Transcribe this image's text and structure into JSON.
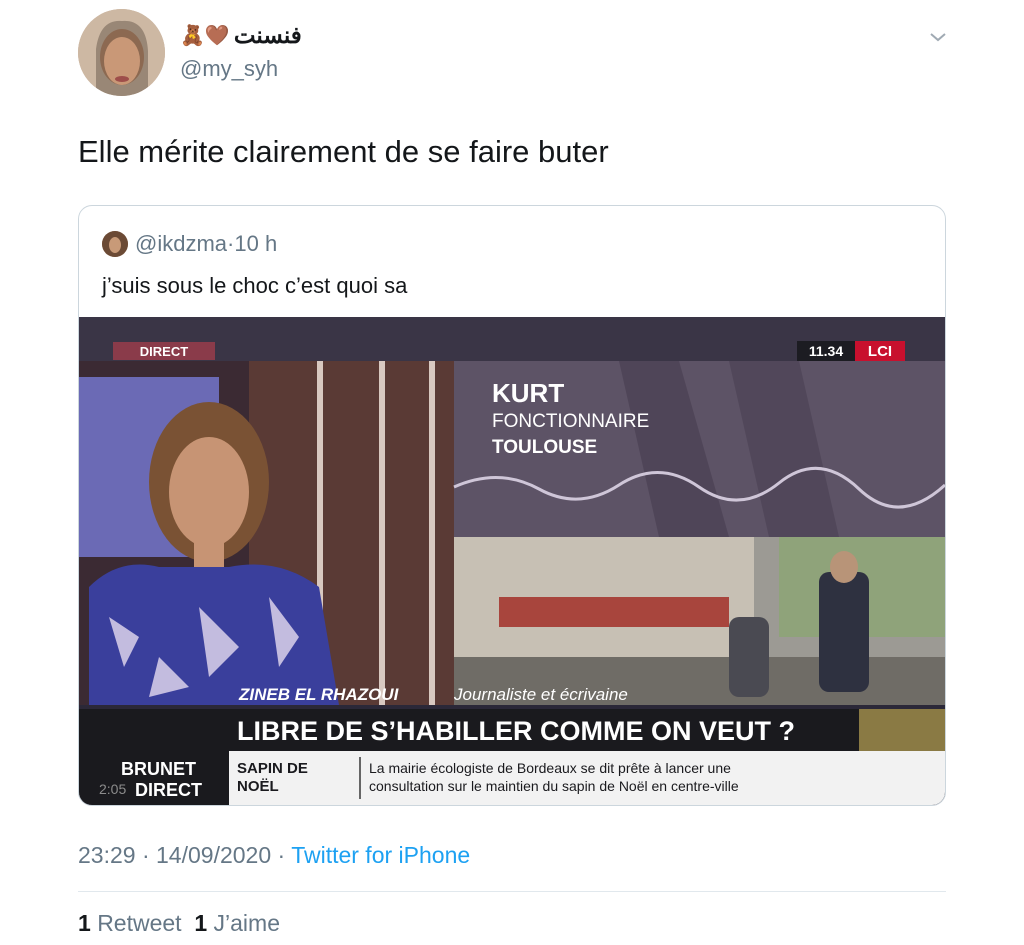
{
  "author": {
    "display_name": "فنسنت",
    "name_emoji": "🧸🤎",
    "handle": "@my_syh"
  },
  "tweet": {
    "text": "Elle mérite clairement de se faire buter"
  },
  "quoted": {
    "handle": "@ikdzma",
    "separator": "·",
    "age": "10 h",
    "text": "j’suis sous le choc c’est quoi sa",
    "video": {
      "live_badge": "DIRECT",
      "clock": "11.34",
      "channel": "LCI",
      "caller_name": "KURT",
      "caller_role": "FONCTIONNAIRE",
      "caller_city": "TOULOUSE",
      "guest_name": "ZINEB EL RHAZOUI",
      "guest_title": "Journaliste et écrivaine",
      "headline": "LIBRE DE S’HABILLER COMME ON VEUT ?",
      "show_name_1": "BRUNET",
      "show_name_2": "DIRECT",
      "timestamp": "2:05",
      "ticker_topic_1": "SAPIN DE",
      "ticker_topic_2": "NOËL",
      "ticker_line_1": "La mairie écologiste de Bordeaux se dit prête à lancer une",
      "ticker_line_2": "consultation sur le maintien du sapin de Noël en centre-ville"
    }
  },
  "meta": {
    "time": "23:29",
    "sep1": "·",
    "date": "14/09/2020",
    "sep2": "·",
    "source": "Twitter for iPhone"
  },
  "stats": {
    "retweets_count": "1",
    "retweets_label": "Retweet",
    "likes_count": "1",
    "likes_label": "J’aime"
  },
  "colors": {
    "link": "#1da1f2",
    "secondary_text": "#657786",
    "lci_red": "#c8102e"
  }
}
